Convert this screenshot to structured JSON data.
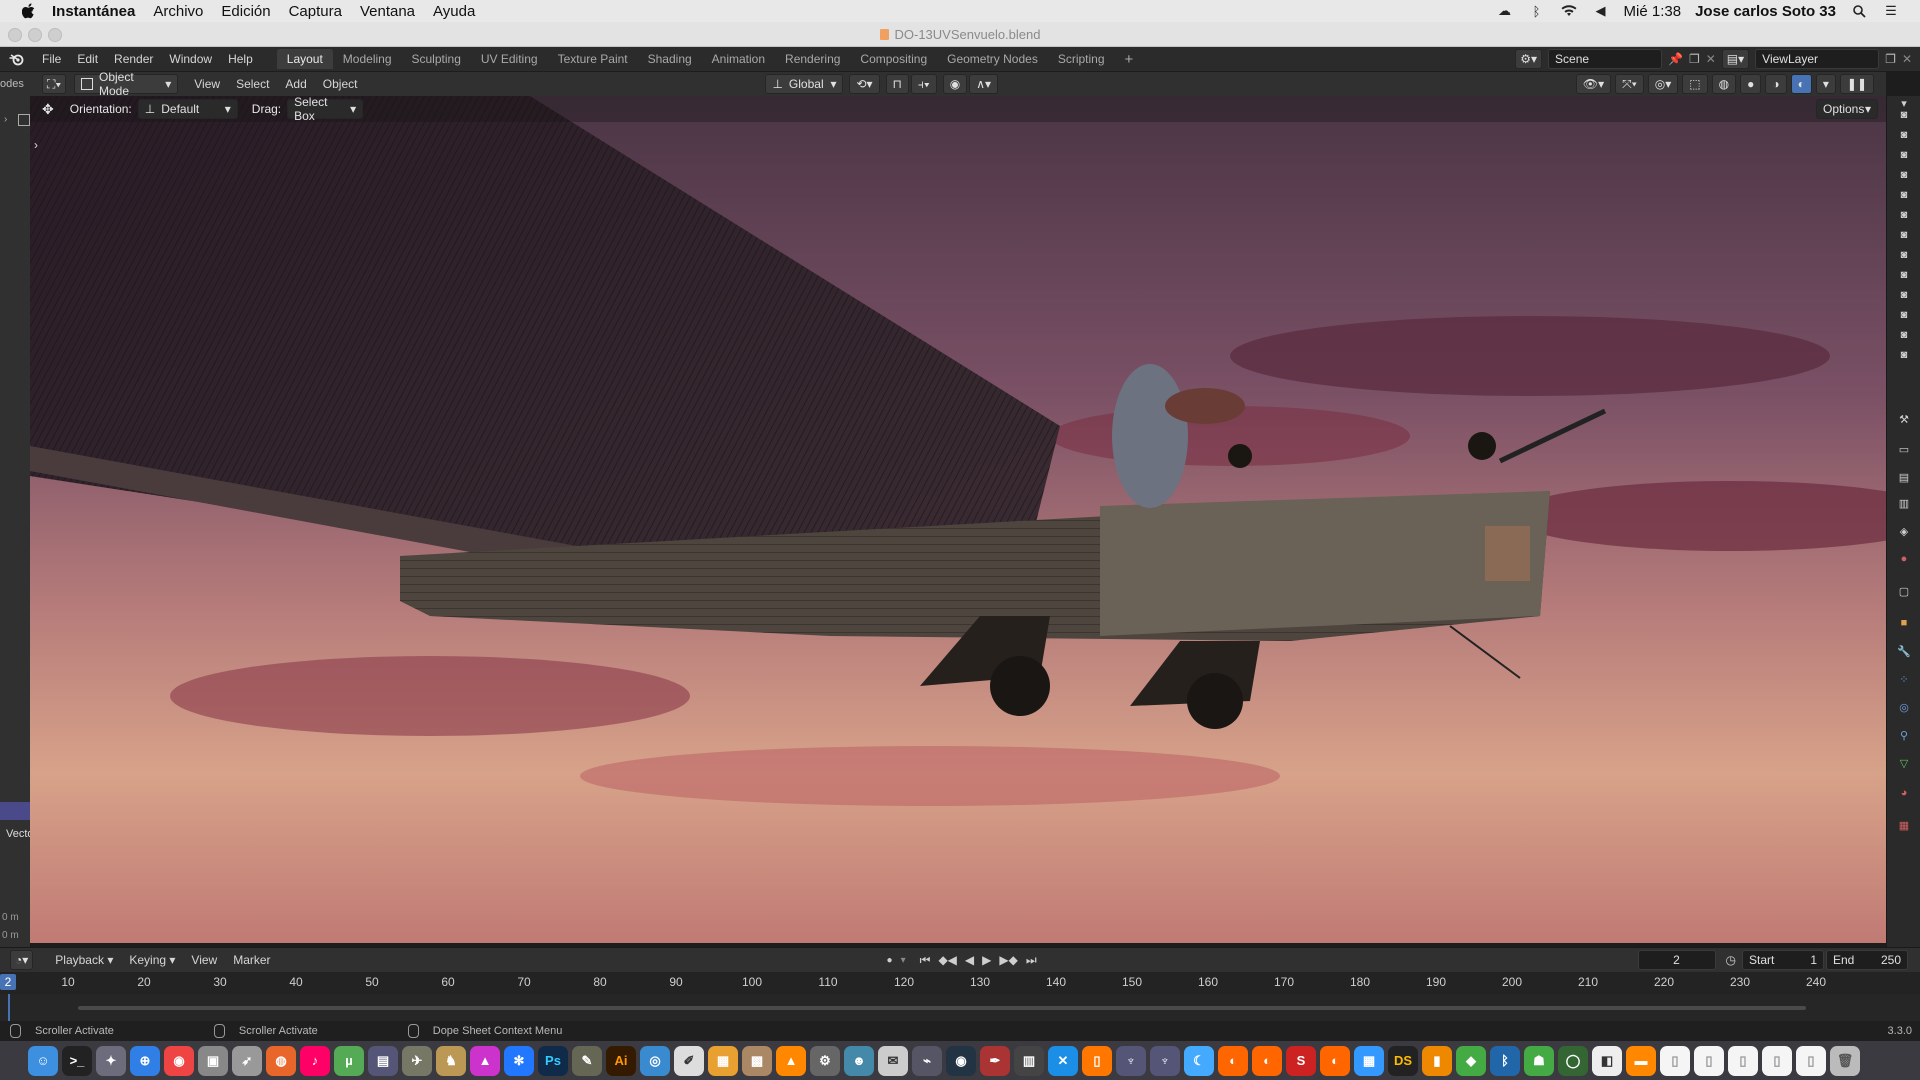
{
  "macos": {
    "app_name": "Instantánea",
    "menus": [
      "Archivo",
      "Edición",
      "Captura",
      "Ventana",
      "Ayuda"
    ],
    "clock": "Mié 1:38",
    "user": "Jose carlos Soto 33"
  },
  "window": {
    "title": "DO-13UVSenvuelo.blend"
  },
  "blender": {
    "menus": [
      "File",
      "Edit",
      "Render",
      "Window",
      "Help"
    ],
    "workspaces": [
      "Layout",
      "Modeling",
      "Sculpting",
      "UV Editing",
      "Texture Paint",
      "Shading",
      "Animation",
      "Rendering",
      "Compositing",
      "Geometry Nodes",
      "Scripting"
    ],
    "active_workspace": "Layout",
    "scene": "Scene",
    "view_layer": "ViewLayer",
    "left_cut_label": "odes",
    "mode": "Object Mode",
    "view_menus": [
      "View",
      "Select",
      "Add",
      "Object"
    ],
    "transform_space": "Global",
    "orientation_label": "Orientation:",
    "orientation_value": "Default",
    "drag_label": "Drag:",
    "drag_value": "Select Box",
    "options_label": "Options",
    "vector_label": "Vecto",
    "unit_a": "0 m",
    "unit_b": "0 m"
  },
  "timeline": {
    "menus": [
      "Playback",
      "Keying",
      "View",
      "Marker"
    ],
    "current_frame": "2",
    "start_label": "Start",
    "start_value": "1",
    "end_label": "End",
    "end_value": "250",
    "frame_marker": "2",
    "ticks": [
      "10",
      "20",
      "30",
      "40",
      "50",
      "60",
      "70",
      "80",
      "90",
      "100",
      "110",
      "120",
      "130",
      "140",
      "150",
      "160",
      "170",
      "180",
      "190",
      "200",
      "210",
      "220",
      "230",
      "240"
    ]
  },
  "status": {
    "items": [
      "Scroller Activate",
      "Scroller Activate",
      "Dope Sheet Context Menu"
    ],
    "version": "3.3.0"
  },
  "dock": {
    "apps": [
      "finder-icon",
      "terminal-icon",
      "launchpad-icon",
      "safari-icon",
      "chrome-icon",
      "app-icon",
      "rocket-icon",
      "firefox-icon",
      "music-icon",
      "utorrent-icon",
      "app-icon",
      "app-icon",
      "app-icon",
      "affinity-icon",
      "app-store-icon",
      "photoshop-icon",
      "gimp-icon",
      "illustrator-icon",
      "app-icon",
      "app-icon",
      "app-icon",
      "app-icon",
      "vlc-icon",
      "settings-icon",
      "app-icon",
      "app-icon",
      "app-icon",
      "app-icon",
      "app-icon",
      "app-icon",
      "xcode-icon",
      "books-icon",
      "app-icon",
      "app-icon",
      "app-icon",
      "blender-icon",
      "blender-icon",
      "app-icon",
      "blender-icon",
      "app-icon",
      "daz-icon",
      "app-icon",
      "app-icon",
      "bluetooth-icon",
      "android-icon",
      "app-icon",
      "app-icon",
      "app-icon",
      "doc-icon",
      "doc-icon",
      "doc-icon",
      "doc-icon",
      "doc-icon",
      "trash-icon"
    ],
    "photoshop_text": "Ps",
    "illustrator_text": "Ai",
    "daz_text": "DS"
  },
  "colors": {
    "accent": "#4772b3",
    "active_workspace_bg": "#3d3d3d",
    "frame_marker": "#4772b3"
  }
}
